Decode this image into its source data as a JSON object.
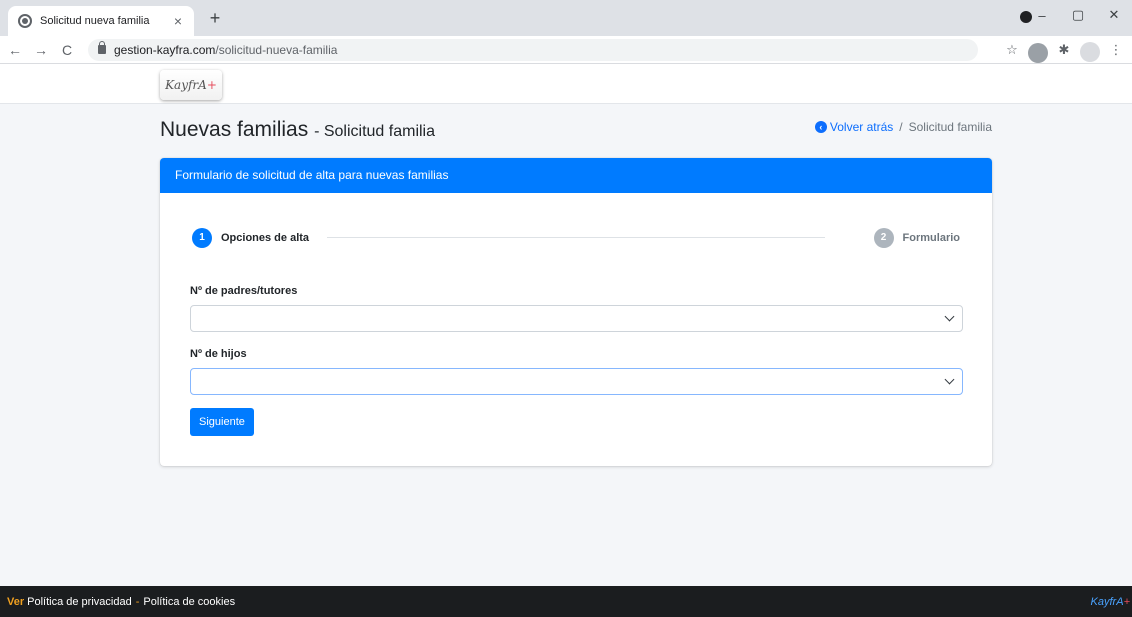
{
  "browser": {
    "tab_title": "Solicitud nueva familia",
    "tab_close": "×",
    "new_tab": "+",
    "url_domain": "gestion-kayfra.com",
    "url_path": "/solicitud-nueva-familia",
    "controls": {
      "minimize": "–",
      "maximize": "▢",
      "close": "✕"
    },
    "nav": {
      "back": "←",
      "forward": "→",
      "reload": "C"
    }
  },
  "header": {
    "logo_text": "KayfrA",
    "logo_plus": "+"
  },
  "page": {
    "title": "Nuevas familias",
    "subtitle": "- Solicitud familia",
    "breadcrumb": {
      "back_label": "Volver atrás",
      "separator": "/",
      "current": "Solicitud familia"
    }
  },
  "card": {
    "header": "Formulario de solicitud de alta para nuevas familias",
    "steps": [
      {
        "number": "1",
        "label": "Opciones de alta",
        "state": "active"
      },
      {
        "number": "2",
        "label": "Formulario",
        "state": "inactive"
      }
    ],
    "fields": [
      {
        "label": "Nº de padres/tutores",
        "value": ""
      },
      {
        "label": "Nº de hijos",
        "value": ""
      }
    ],
    "next_label": "Siguiente"
  },
  "footer": {
    "ver": "Ver",
    "privacy": "Política de privacidad",
    "dash": "-",
    "cookies": "Política de cookies",
    "brand": "KayfrA",
    "brand_plus": "+"
  },
  "colors": {
    "primary": "#007bff",
    "footer_bg": "#1b1d1f",
    "accent_orange": "#f0a020"
  }
}
